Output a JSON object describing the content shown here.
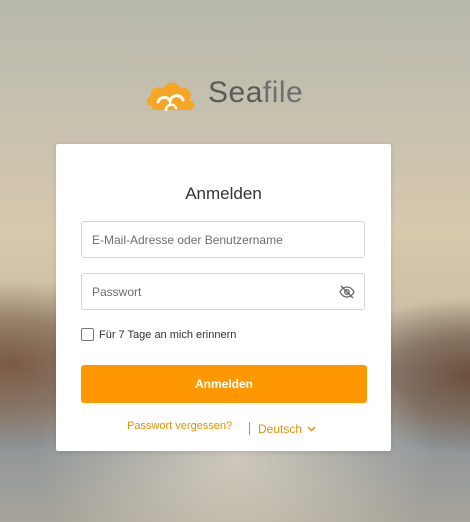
{
  "logo": {
    "text_a": "Sea",
    "text_b": "file"
  },
  "login": {
    "title": "Anmelden",
    "email_placeholder": "E-Mail-Adresse oder Benutzername",
    "password_placeholder": "Passwort",
    "remember_label": "Für 7 Tage an mich erinnern",
    "submit_label": "Anmelden",
    "forgot_label": "Passwort vergessen?",
    "language": "Deutsch"
  },
  "colors": {
    "accent": "#ff9800",
    "link": "#e69000"
  },
  "icons": {
    "password_toggle": "eye-off-icon",
    "language_dropdown": "chevron-down-icon"
  }
}
